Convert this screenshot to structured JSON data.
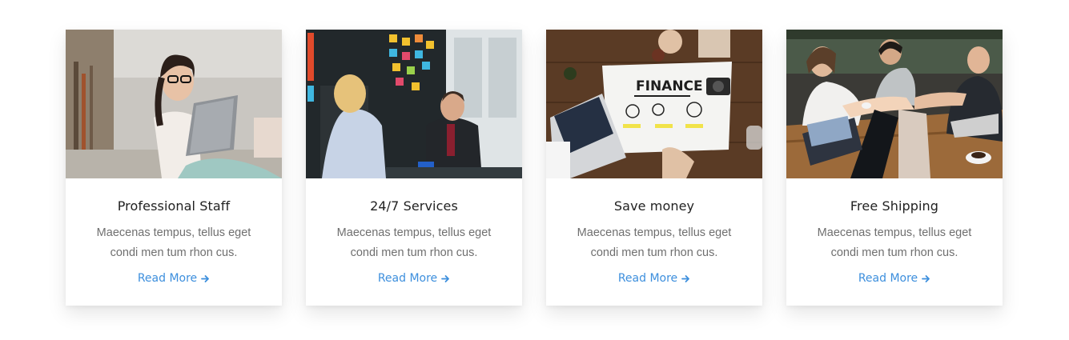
{
  "cards": [
    {
      "image": "photo-woman-with-laptop",
      "title": "Professional Staff",
      "text": "Maecenas tempus, tellus eget condi men tum rhon cus.",
      "link_label": "Read More"
    },
    {
      "image": "photo-office-meeting",
      "title": "24/7 Services",
      "text": "Maecenas tempus, tellus eget condi men tum rhon cus.",
      "link_label": "Read More"
    },
    {
      "image": "photo-finance-desk",
      "image_text": "FINANCE",
      "title": "Save money",
      "text": "Maecenas tempus, tellus eget condi men tum rhon cus.",
      "link_label": "Read More"
    },
    {
      "image": "photo-team-hands",
      "title": "Free Shipping",
      "text": "Maecenas tempus, tellus eget condi men tum rhon cus.",
      "link_label": "Read More"
    }
  ],
  "link_icon": "arrow-right-icon",
  "colors": {
    "link": "#3d8fdd",
    "title": "#222222",
    "text": "#6f6f6f"
  }
}
